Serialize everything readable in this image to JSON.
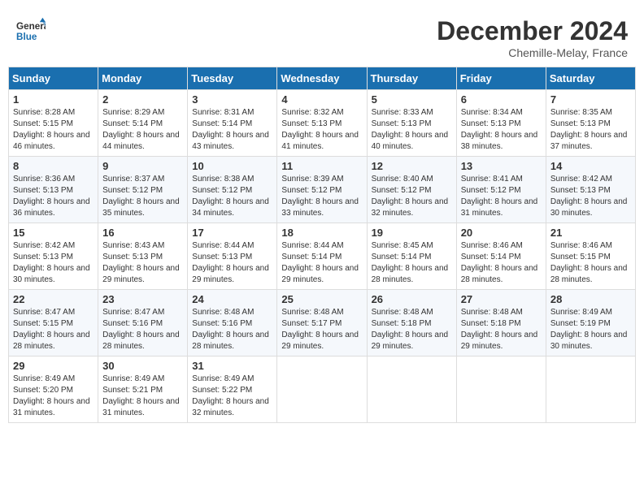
{
  "header": {
    "logo_line1": "General",
    "logo_line2": "Blue",
    "month_year": "December 2024",
    "location": "Chemille-Melay, France"
  },
  "weekdays": [
    "Sunday",
    "Monday",
    "Tuesday",
    "Wednesday",
    "Thursday",
    "Friday",
    "Saturday"
  ],
  "weeks": [
    [
      {
        "day": "1",
        "sunrise": "Sunrise: 8:28 AM",
        "sunset": "Sunset: 5:15 PM",
        "daylight": "Daylight: 8 hours and 46 minutes."
      },
      {
        "day": "2",
        "sunrise": "Sunrise: 8:29 AM",
        "sunset": "Sunset: 5:14 PM",
        "daylight": "Daylight: 8 hours and 44 minutes."
      },
      {
        "day": "3",
        "sunrise": "Sunrise: 8:31 AM",
        "sunset": "Sunset: 5:14 PM",
        "daylight": "Daylight: 8 hours and 43 minutes."
      },
      {
        "day": "4",
        "sunrise": "Sunrise: 8:32 AM",
        "sunset": "Sunset: 5:13 PM",
        "daylight": "Daylight: 8 hours and 41 minutes."
      },
      {
        "day": "5",
        "sunrise": "Sunrise: 8:33 AM",
        "sunset": "Sunset: 5:13 PM",
        "daylight": "Daylight: 8 hours and 40 minutes."
      },
      {
        "day": "6",
        "sunrise": "Sunrise: 8:34 AM",
        "sunset": "Sunset: 5:13 PM",
        "daylight": "Daylight: 8 hours and 38 minutes."
      },
      {
        "day": "7",
        "sunrise": "Sunrise: 8:35 AM",
        "sunset": "Sunset: 5:13 PM",
        "daylight": "Daylight: 8 hours and 37 minutes."
      }
    ],
    [
      {
        "day": "8",
        "sunrise": "Sunrise: 8:36 AM",
        "sunset": "Sunset: 5:13 PM",
        "daylight": "Daylight: 8 hours and 36 minutes."
      },
      {
        "day": "9",
        "sunrise": "Sunrise: 8:37 AM",
        "sunset": "Sunset: 5:12 PM",
        "daylight": "Daylight: 8 hours and 35 minutes."
      },
      {
        "day": "10",
        "sunrise": "Sunrise: 8:38 AM",
        "sunset": "Sunset: 5:12 PM",
        "daylight": "Daylight: 8 hours and 34 minutes."
      },
      {
        "day": "11",
        "sunrise": "Sunrise: 8:39 AM",
        "sunset": "Sunset: 5:12 PM",
        "daylight": "Daylight: 8 hours and 33 minutes."
      },
      {
        "day": "12",
        "sunrise": "Sunrise: 8:40 AM",
        "sunset": "Sunset: 5:12 PM",
        "daylight": "Daylight: 8 hours and 32 minutes."
      },
      {
        "day": "13",
        "sunrise": "Sunrise: 8:41 AM",
        "sunset": "Sunset: 5:12 PM",
        "daylight": "Daylight: 8 hours and 31 minutes."
      },
      {
        "day": "14",
        "sunrise": "Sunrise: 8:42 AM",
        "sunset": "Sunset: 5:13 PM",
        "daylight": "Daylight: 8 hours and 30 minutes."
      }
    ],
    [
      {
        "day": "15",
        "sunrise": "Sunrise: 8:42 AM",
        "sunset": "Sunset: 5:13 PM",
        "daylight": "Daylight: 8 hours and 30 minutes."
      },
      {
        "day": "16",
        "sunrise": "Sunrise: 8:43 AM",
        "sunset": "Sunset: 5:13 PM",
        "daylight": "Daylight: 8 hours and 29 minutes."
      },
      {
        "day": "17",
        "sunrise": "Sunrise: 8:44 AM",
        "sunset": "Sunset: 5:13 PM",
        "daylight": "Daylight: 8 hours and 29 minutes."
      },
      {
        "day": "18",
        "sunrise": "Sunrise: 8:44 AM",
        "sunset": "Sunset: 5:14 PM",
        "daylight": "Daylight: 8 hours and 29 minutes."
      },
      {
        "day": "19",
        "sunrise": "Sunrise: 8:45 AM",
        "sunset": "Sunset: 5:14 PM",
        "daylight": "Daylight: 8 hours and 28 minutes."
      },
      {
        "day": "20",
        "sunrise": "Sunrise: 8:46 AM",
        "sunset": "Sunset: 5:14 PM",
        "daylight": "Daylight: 8 hours and 28 minutes."
      },
      {
        "day": "21",
        "sunrise": "Sunrise: 8:46 AM",
        "sunset": "Sunset: 5:15 PM",
        "daylight": "Daylight: 8 hours and 28 minutes."
      }
    ],
    [
      {
        "day": "22",
        "sunrise": "Sunrise: 8:47 AM",
        "sunset": "Sunset: 5:15 PM",
        "daylight": "Daylight: 8 hours and 28 minutes."
      },
      {
        "day": "23",
        "sunrise": "Sunrise: 8:47 AM",
        "sunset": "Sunset: 5:16 PM",
        "daylight": "Daylight: 8 hours and 28 minutes."
      },
      {
        "day": "24",
        "sunrise": "Sunrise: 8:48 AM",
        "sunset": "Sunset: 5:16 PM",
        "daylight": "Daylight: 8 hours and 28 minutes."
      },
      {
        "day": "25",
        "sunrise": "Sunrise: 8:48 AM",
        "sunset": "Sunset: 5:17 PM",
        "daylight": "Daylight: 8 hours and 29 minutes."
      },
      {
        "day": "26",
        "sunrise": "Sunrise: 8:48 AM",
        "sunset": "Sunset: 5:18 PM",
        "daylight": "Daylight: 8 hours and 29 minutes."
      },
      {
        "day": "27",
        "sunrise": "Sunrise: 8:48 AM",
        "sunset": "Sunset: 5:18 PM",
        "daylight": "Daylight: 8 hours and 29 minutes."
      },
      {
        "day": "28",
        "sunrise": "Sunrise: 8:49 AM",
        "sunset": "Sunset: 5:19 PM",
        "daylight": "Daylight: 8 hours and 30 minutes."
      }
    ],
    [
      {
        "day": "29",
        "sunrise": "Sunrise: 8:49 AM",
        "sunset": "Sunset: 5:20 PM",
        "daylight": "Daylight: 8 hours and 31 minutes."
      },
      {
        "day": "30",
        "sunrise": "Sunrise: 8:49 AM",
        "sunset": "Sunset: 5:21 PM",
        "daylight": "Daylight: 8 hours and 31 minutes."
      },
      {
        "day": "31",
        "sunrise": "Sunrise: 8:49 AM",
        "sunset": "Sunset: 5:22 PM",
        "daylight": "Daylight: 8 hours and 32 minutes."
      },
      null,
      null,
      null,
      null
    ]
  ]
}
